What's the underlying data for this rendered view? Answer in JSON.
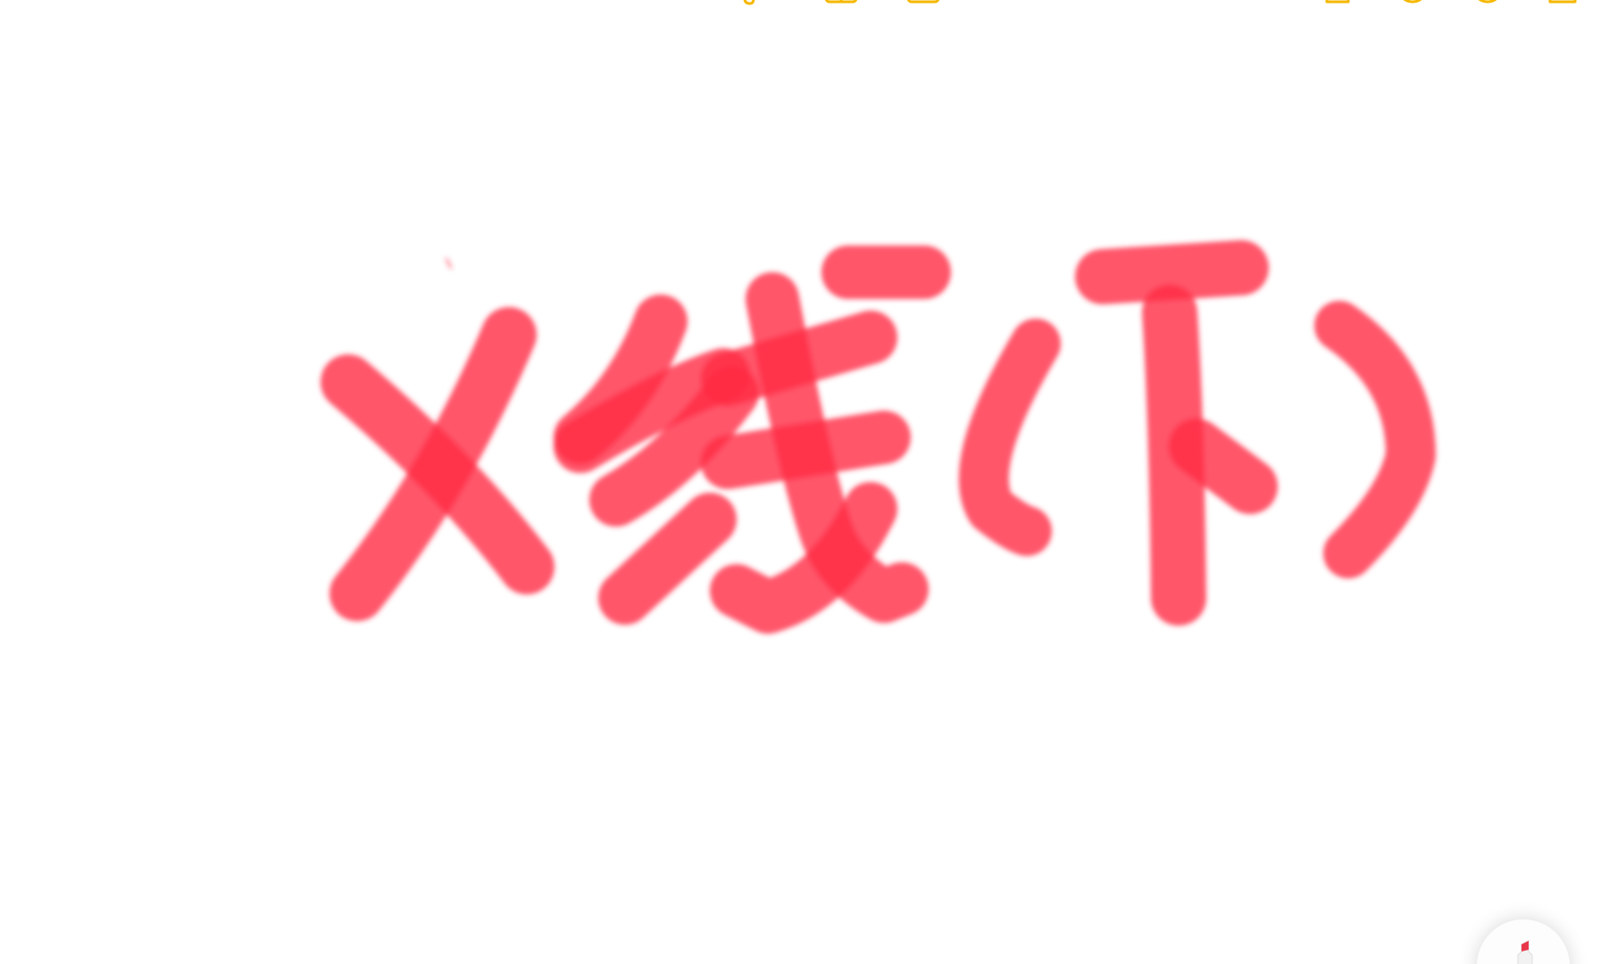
{
  "toolbar": {
    "accent_color": "#F5B800",
    "icons": [
      "back-chevron-icon",
      "attachment-icon",
      "table-icon",
      "checklist-icon",
      "share-icon",
      "markup-icon",
      "collaborate-icon",
      "new-note-icon"
    ]
  },
  "drawing": {
    "ink_color": "#FF2D43",
    "tool": "marker",
    "text": "X线(下)"
  },
  "tool_button": {
    "icon": "marker-tool-icon",
    "tip_color": "#E8394B"
  }
}
